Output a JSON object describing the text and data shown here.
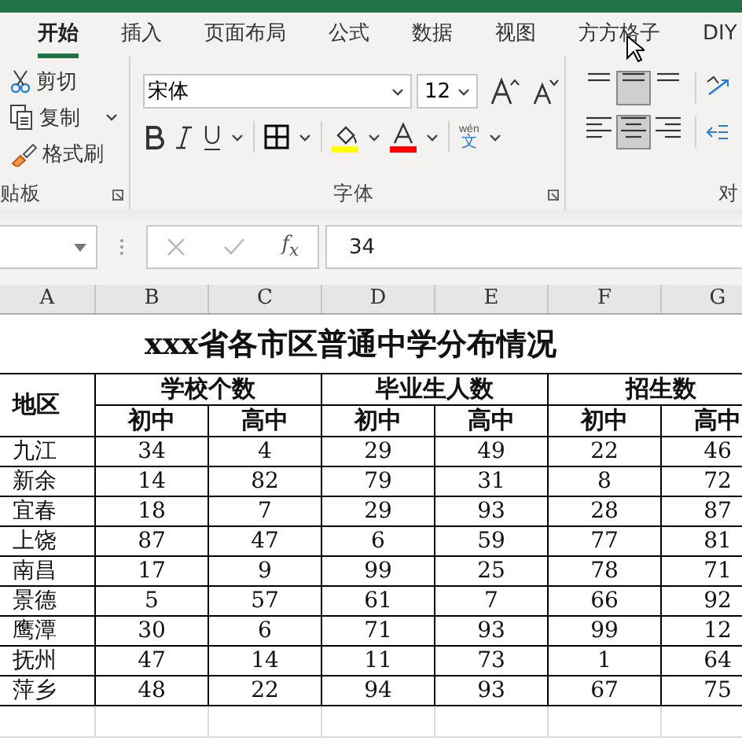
{
  "tabs": [
    {
      "label": "开始",
      "selected": true
    },
    {
      "label": "插入",
      "selected": false
    },
    {
      "label": "页面布局",
      "selected": false
    },
    {
      "label": "公式",
      "selected": false
    },
    {
      "label": "数据",
      "selected": false
    },
    {
      "label": "视图",
      "selected": false
    },
    {
      "label": "方方格子",
      "selected": false
    },
    {
      "label": "DIY",
      "selected": false
    }
  ],
  "clipboard": {
    "items": [
      {
        "kind": "cut",
        "label": "剪切"
      },
      {
        "kind": "copy",
        "label": "复制"
      },
      {
        "kind": "painter",
        "label": "格式刷"
      }
    ],
    "group_label": "贴板"
  },
  "font": {
    "name": "宋体",
    "size": "12",
    "phonetic_top": "wén",
    "phonetic_bottom": "文",
    "group_label": "字体"
  },
  "alignment": {
    "group_label": "对",
    "buttons": [
      {
        "kind": "top",
        "selected": false
      },
      {
        "kind": "middle",
        "selected": true
      },
      {
        "kind": "bottom",
        "selected": false
      },
      {
        "kind": "left",
        "selected": false
      },
      {
        "kind": "center",
        "selected": true
      },
      {
        "kind": "right",
        "selected": false
      }
    ]
  },
  "formula_bar": {
    "function_label": "f$_{x}$",
    "value": "34"
  },
  "sheet": {
    "columns": [
      "A",
      "B",
      "C",
      "D",
      "E",
      "F",
      "G"
    ],
    "title": "xxx省各市区普通中学分布情况",
    "region_header": "地区",
    "groups": [
      "学校个数",
      "毕业生人数",
      "招生数"
    ],
    "subheaders": [
      "初中",
      "高中",
      "初中",
      "高中",
      "初中",
      "高中"
    ],
    "rows": [
      {
        "region": "九江",
        "values": [
          "34",
          "4",
          "29",
          "49",
          "22",
          "46"
        ]
      },
      {
        "region": "新余",
        "values": [
          "14",
          "82",
          "79",
          "31",
          "8",
          "72"
        ]
      },
      {
        "region": "宜春",
        "values": [
          "18",
          "7",
          "29",
          "93",
          "28",
          "87"
        ]
      },
      {
        "region": "上饶",
        "values": [
          "87",
          "47",
          "6",
          "59",
          "77",
          "81"
        ]
      },
      {
        "region": "南昌",
        "values": [
          "17",
          "9",
          "99",
          "25",
          "78",
          "71"
        ]
      },
      {
        "region": "景德",
        "values": [
          "5",
          "57",
          "61",
          "7",
          "66",
          "92"
        ]
      },
      {
        "region": "鹰潭",
        "values": [
          "30",
          "6",
          "71",
          "93",
          "99",
          "12"
        ]
      },
      {
        "region": "抚州",
        "values": [
          "47",
          "14",
          "11",
          "73",
          "1",
          "64"
        ]
      },
      {
        "region": "萍乡",
        "values": [
          "48",
          "22",
          "94",
          "93",
          "67",
          "75"
        ]
      }
    ]
  }
}
